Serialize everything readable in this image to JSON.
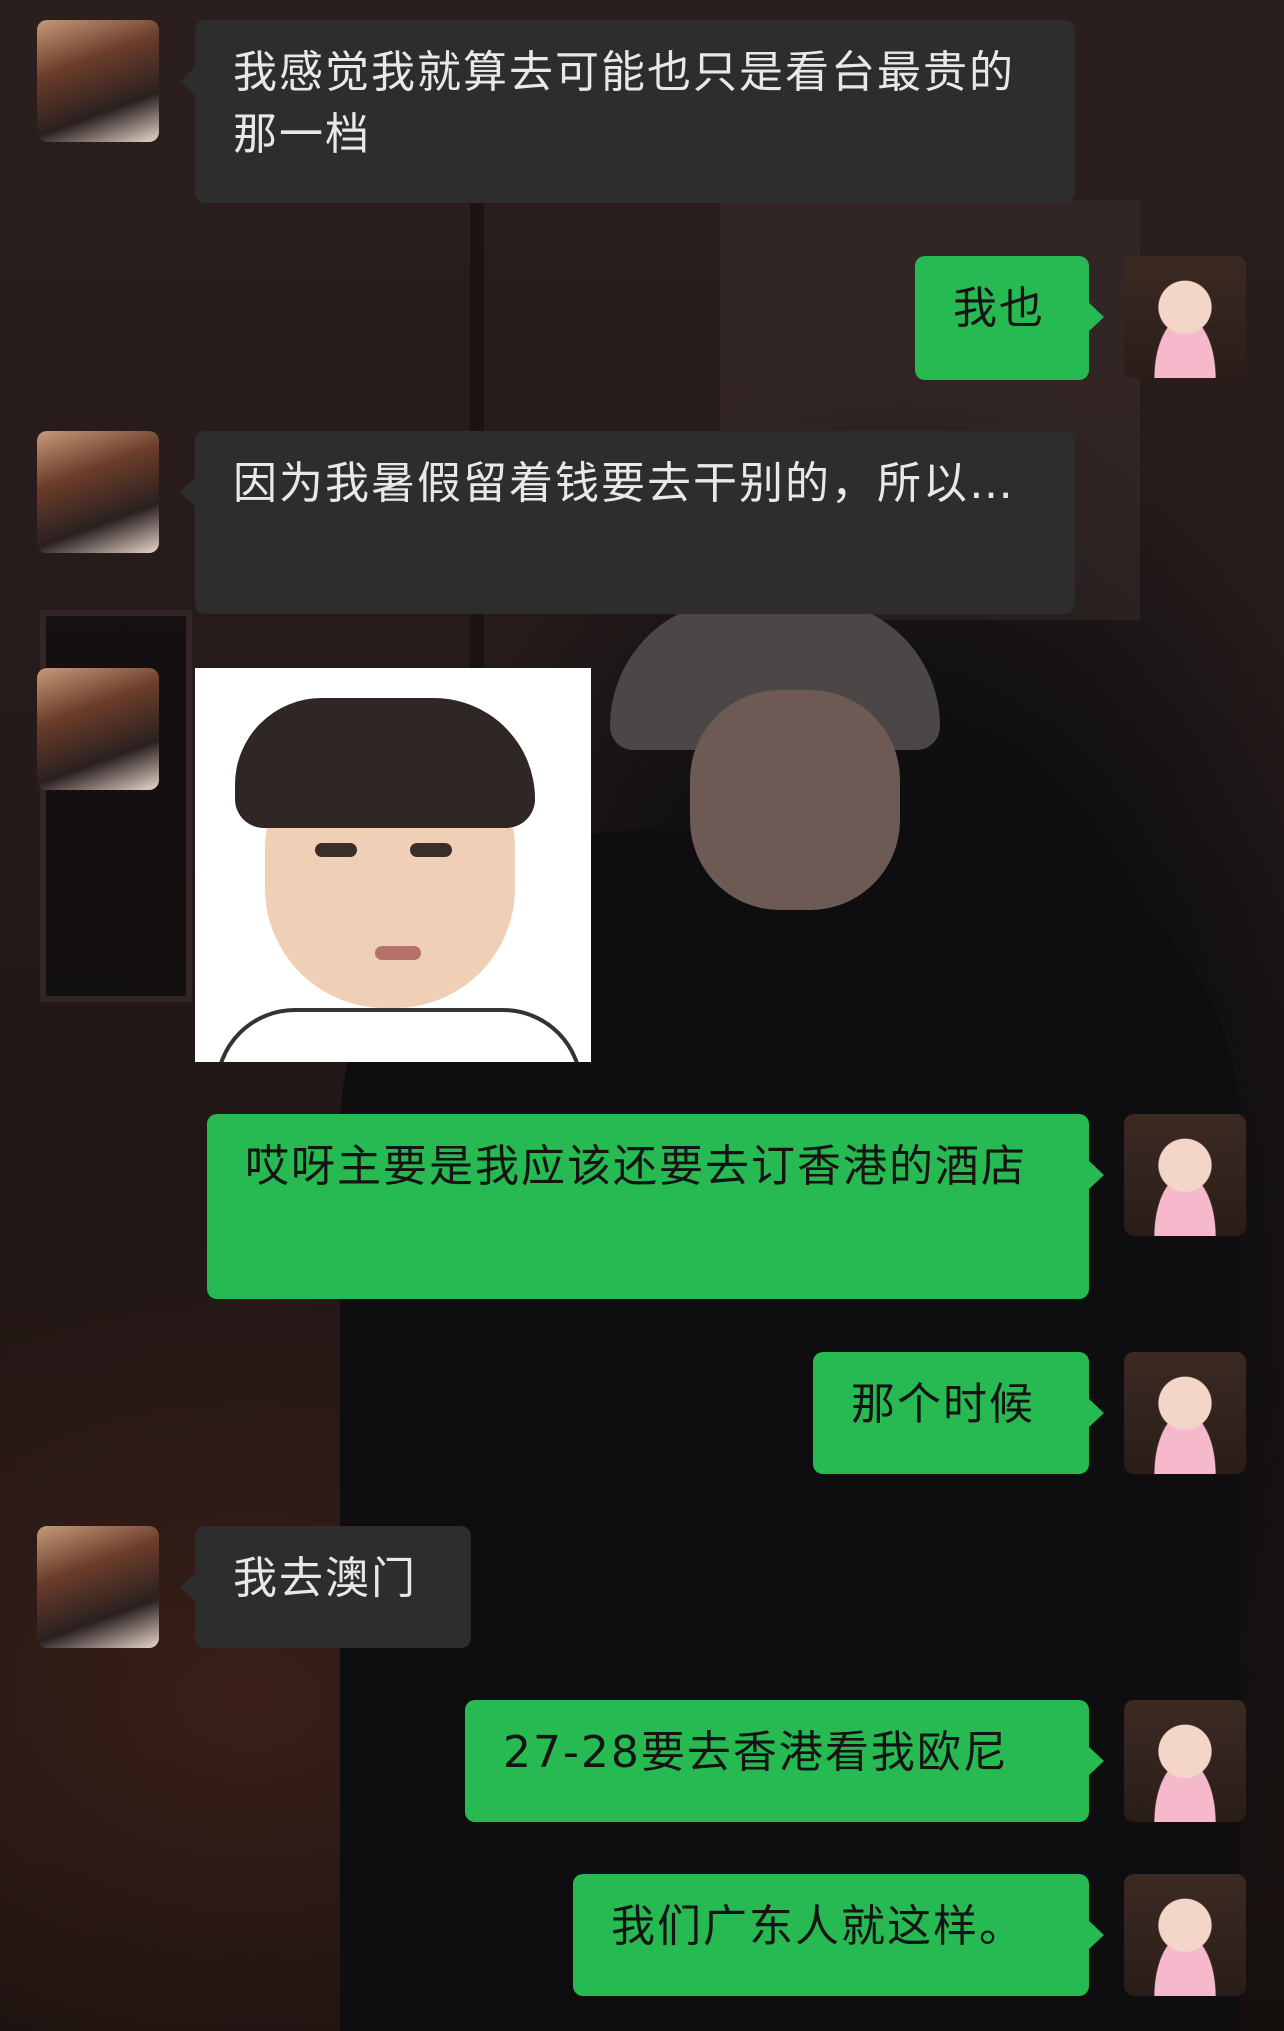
{
  "chat": {
    "messages": [
      {
        "side": "in",
        "text": "我感觉我就算去可能也只是看台最贵的那一档"
      },
      {
        "side": "out",
        "text": "我也"
      },
      {
        "side": "in",
        "text": "因为我暑假留着钱要去干别的，所以…"
      },
      {
        "side": "in",
        "type": "sticker",
        "text": ""
      },
      {
        "side": "out",
        "text": "哎呀主要是我应该还要去订香港的酒店"
      },
      {
        "side": "out",
        "text": "那个时候"
      },
      {
        "side": "in",
        "text": "我去澳门"
      },
      {
        "side": "out",
        "text": "27-28要去香港看我欧尼"
      },
      {
        "side": "out",
        "text": "我们广东人就这样。"
      }
    ]
  },
  "colors": {
    "incoming_bubble": "#2d2d2d",
    "outgoing_bubble": "#28ba52",
    "incoming_text": "#e8e8e8",
    "outgoing_text": "#141414"
  },
  "icons": {
    "left_avatar": "contact-avatar",
    "right_avatar": "self-avatar",
    "sticker": "face-sticker"
  }
}
